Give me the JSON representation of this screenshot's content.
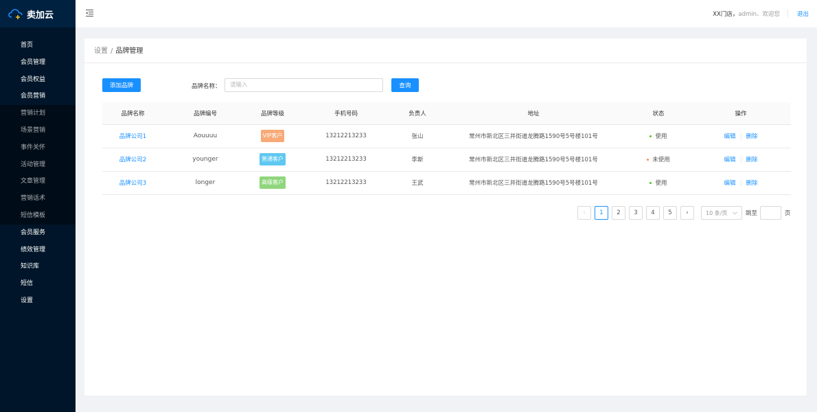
{
  "app": {
    "name": "卖加云"
  },
  "sidebar": {
    "items": [
      {
        "label": "首页",
        "sub": false
      },
      {
        "label": "会员管理",
        "sub": false
      },
      {
        "label": "会员权益",
        "sub": false
      },
      {
        "label": "会员营销",
        "sub": false
      },
      {
        "label": "营销计划",
        "sub": true
      },
      {
        "label": "场景营销",
        "sub": true
      },
      {
        "label": "事件关怀",
        "sub": true
      },
      {
        "label": "活动管理",
        "sub": true
      },
      {
        "label": "文章管理",
        "sub": true
      },
      {
        "label": "营销话术",
        "sub": true
      },
      {
        "label": "短信模板",
        "sub": true
      },
      {
        "label": "会员服务",
        "sub": false
      },
      {
        "label": "绩效管理",
        "sub": false
      },
      {
        "label": "知识库",
        "sub": false
      },
      {
        "label": "短信",
        "sub": false
      },
      {
        "label": "设置",
        "sub": false
      }
    ]
  },
  "header": {
    "shop": "XX门店，",
    "user": "admin、欢迎您",
    "logout": "退出"
  },
  "breadcrumb": {
    "parent": "设置",
    "separator": "/",
    "current": "品牌管理"
  },
  "toolbar": {
    "add_label": "添加品牌",
    "search_label": "品牌名称：",
    "search_placeholder": "请输入",
    "search_value": "",
    "query_label": "查询"
  },
  "table": {
    "headers": [
      "品牌名称",
      "品牌编号",
      "品牌等级",
      "手机号码",
      "负责人",
      "地址",
      "状态",
      "操作"
    ],
    "rows": [
      {
        "name": "品牌公司1",
        "code": "Aouuuu",
        "level": "VIP客户",
        "level_color": "#f8a978",
        "phone": "13212213233",
        "owner": "张山",
        "address": "常州市新北区三井街道龙腾路1590号5号楼101号",
        "status": "使用",
        "status_color": "#52c41a",
        "edit": "编辑",
        "delete": "删除"
      },
      {
        "name": "品牌公司2",
        "code": "younger",
        "level": "普通客户",
        "level_color": "#5ec8f0",
        "phone": "13212213233",
        "owner": "李斯",
        "address": "常州市新北区三井街道龙腾路1590号5号楼101号",
        "status": "未使用",
        "status_color": "#fa8c5a",
        "edit": "编辑",
        "delete": "删除"
      },
      {
        "name": "品牌公司3",
        "code": "longer",
        "level": "高级客户",
        "level_color": "#8fd67c",
        "phone": "13212213233",
        "owner": "王武",
        "address": "常州市新北区三井街道龙腾路1590号5号楼101号",
        "status": "使用",
        "status_color": "#52c41a",
        "edit": "编辑",
        "delete": "删除"
      }
    ]
  },
  "pagination": {
    "prev_icon": "chevron-left-icon",
    "pages": [
      "1",
      "2",
      "3",
      "4",
      "5"
    ],
    "current": "1",
    "next_icon": "chevron-right-icon",
    "page_size": "10 条/页",
    "jump_label": "跳至",
    "jump_value": "",
    "page_unit": "页"
  },
  "colors": {
    "primary": "#1890ff",
    "sidebar": "#001529",
    "sidebar_sub": "#000c17",
    "logo_bg": "#002140"
  }
}
